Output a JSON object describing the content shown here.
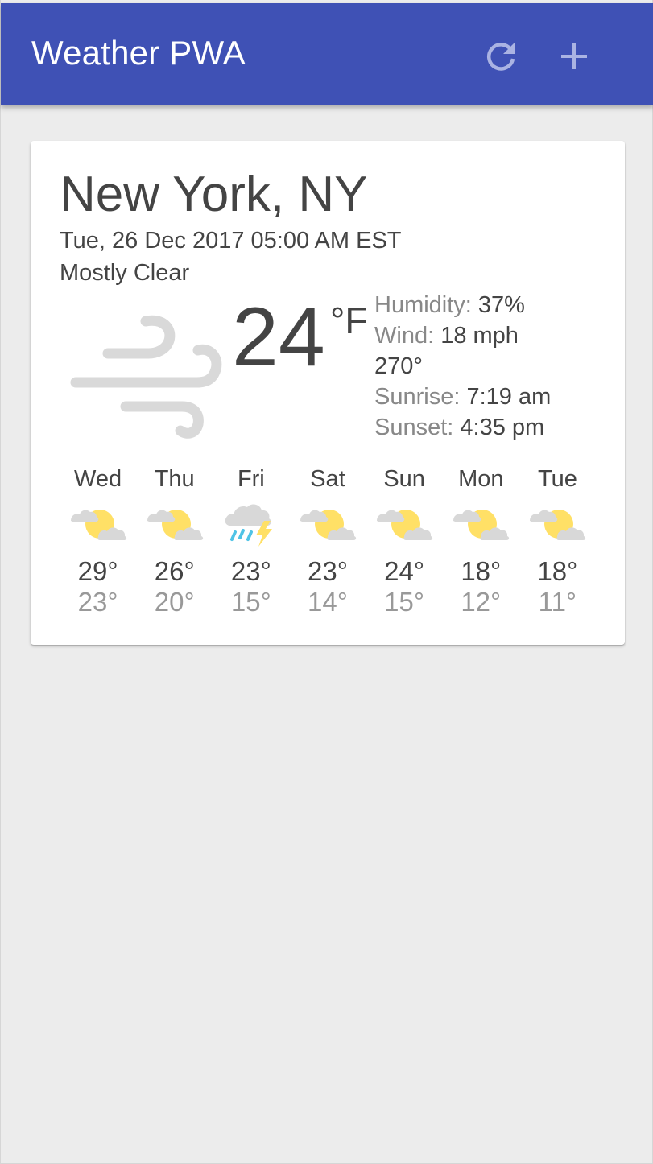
{
  "header": {
    "title": "Weather PWA",
    "refresh_icon": "refresh-icon",
    "add_icon": "add-icon"
  },
  "card": {
    "location": "New York, NY",
    "date": "Tue, 26 Dec 2017 05:00 AM EST",
    "description": "Mostly Clear",
    "current_icon": "wind-icon",
    "temperature": "24",
    "unit": "°F",
    "humidity_label": "Humidity:",
    "humidity": "37%",
    "wind_label": "Wind:",
    "wind_speed": "18 mph",
    "wind_direction": "270°",
    "sunrise_label": "Sunrise:",
    "sunrise": "7:19 am",
    "sunset_label": "Sunset:",
    "sunset": "4:35 pm"
  },
  "forecast": [
    {
      "day": "Wed",
      "icon": "partly-cloudy-icon",
      "high": "29°",
      "low": "23°"
    },
    {
      "day": "Thu",
      "icon": "partly-cloudy-icon",
      "high": "26°",
      "low": "20°"
    },
    {
      "day": "Fri",
      "icon": "thunderstorm-icon",
      "high": "23°",
      "low": "15°"
    },
    {
      "day": "Sat",
      "icon": "partly-cloudy-icon",
      "high": "23°",
      "low": "14°"
    },
    {
      "day": "Sun",
      "icon": "partly-cloudy-icon",
      "high": "24°",
      "low": "15°"
    },
    {
      "day": "Mon",
      "icon": "partly-cloudy-icon",
      "high": "18°",
      "low": "12°"
    },
    {
      "day": "Tue",
      "icon": "partly-cloudy-icon",
      "high": "18°",
      "low": "11°"
    }
  ],
  "colors": {
    "header_bg": "#3f51b5",
    "page_bg": "#ececec",
    "sun": "#ffe066",
    "cloud": "#d8d8d8",
    "rain": "#4fc3e6",
    "lightning": "#ffe066"
  }
}
